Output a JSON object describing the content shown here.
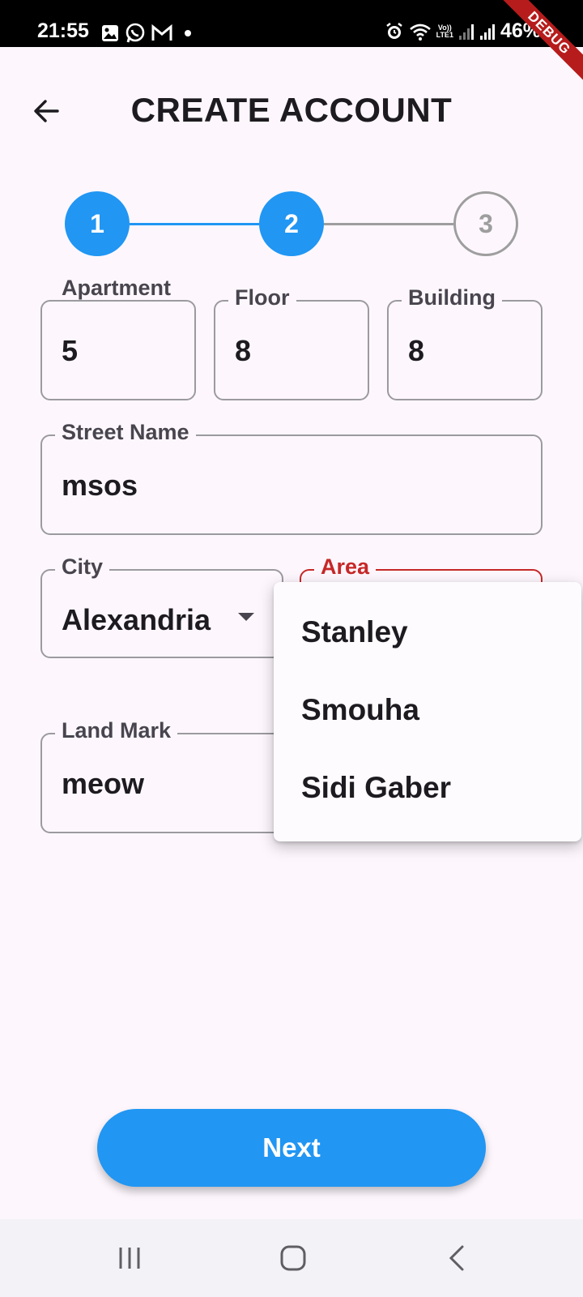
{
  "status_bar": {
    "time": "21:55",
    "battery": "46%",
    "volte_label": "Vo))",
    "lte_label": "LTE1",
    "notification_icons": [
      "gallery-icon",
      "whatsapp-icon",
      "gmail-icon"
    ],
    "status_icons": [
      "alarm-icon",
      "wifi-icon",
      "signal-icon",
      "signal-icon"
    ]
  },
  "debug_banner": "DEBUG",
  "app_bar": {
    "title": "CREATE ACCOUNT",
    "back_icon": "arrow-back-icon"
  },
  "stepper": {
    "steps": [
      {
        "label": "1",
        "state": "done"
      },
      {
        "label": "2",
        "state": "current"
      },
      {
        "label": "3",
        "state": "upcoming"
      }
    ],
    "active_color": "#2196f3",
    "inactive_color": "#9e9e9e"
  },
  "form": {
    "apartment": {
      "label": "Apartment",
      "value": "5"
    },
    "floor": {
      "label": "Floor",
      "value": "8"
    },
    "building": {
      "label": "Building",
      "value": "8"
    },
    "street_name": {
      "label": "Street Name",
      "value": "msos"
    },
    "city": {
      "label": "City",
      "value": "Alexandria"
    },
    "area": {
      "label": "Area",
      "value": "",
      "error_color": "#c62828"
    },
    "land_mark": {
      "label": "Land Mark",
      "value": "meow"
    }
  },
  "area_menu": {
    "options": [
      "Stanley",
      "Smouha",
      "Sidi Gaber"
    ]
  },
  "next_button": {
    "label": "Next",
    "color": "#2196f3"
  },
  "nav_bar": {
    "icons": [
      "recents-icon",
      "home-icon",
      "back-icon"
    ]
  }
}
